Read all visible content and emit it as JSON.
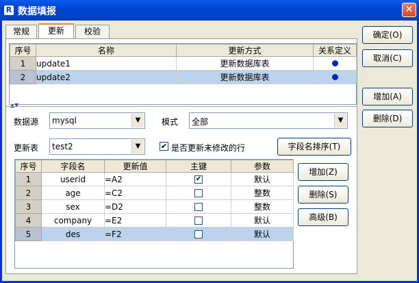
{
  "window": {
    "title": "数据填报",
    "logo": "R",
    "close_label": "✕"
  },
  "tabs": [
    {
      "label": "常规"
    },
    {
      "label": "更新"
    },
    {
      "label": "校验"
    }
  ],
  "update_table": {
    "headers": [
      "序号",
      "名称",
      "更新方式",
      "关系定义"
    ],
    "rows": [
      {
        "num": "1",
        "name": "update1",
        "mode": "更新数据库表"
      },
      {
        "num": "2",
        "name": "update2",
        "mode": "更新数据库表"
      }
    ]
  },
  "form": {
    "datasource_label": "数据源",
    "datasource_value": "mysql",
    "mode_label": "模式",
    "mode_value": "全部",
    "table_label": "更新表",
    "table_value": "test2",
    "update_unchanged_label": "是否更新未修改的行",
    "sort_button": "字段名排序(T)"
  },
  "field_table": {
    "headers": [
      "序号",
      "字段名",
      "更新值",
      "主键",
      "参数"
    ],
    "rows": [
      {
        "num": "1",
        "field": "userid",
        "value": "=A2",
        "key": "✔",
        "param": "默认"
      },
      {
        "num": "2",
        "field": "age",
        "value": "=C2",
        "key": "",
        "param": "整数"
      },
      {
        "num": "3",
        "field": "sex",
        "value": "=D2",
        "key": "",
        "param": "整数"
      },
      {
        "num": "4",
        "field": "company",
        "value": "=E2",
        "key": "",
        "param": "默认"
      },
      {
        "num": "5",
        "field": "des",
        "value": "=F2",
        "key": "",
        "param": "默认"
      }
    ]
  },
  "field_buttons": {
    "add": "增加(Z)",
    "delete": "删除(S)",
    "advanced": "高级(B)"
  },
  "side_buttons": {
    "ok": "确定(O)",
    "cancel": "取消(C)",
    "add": "增加(A)",
    "delete": "删除(D)"
  },
  "splitter_glyph": "▲▼",
  "combo_arrow": "▼",
  "checkbox_glyph": "✔"
}
